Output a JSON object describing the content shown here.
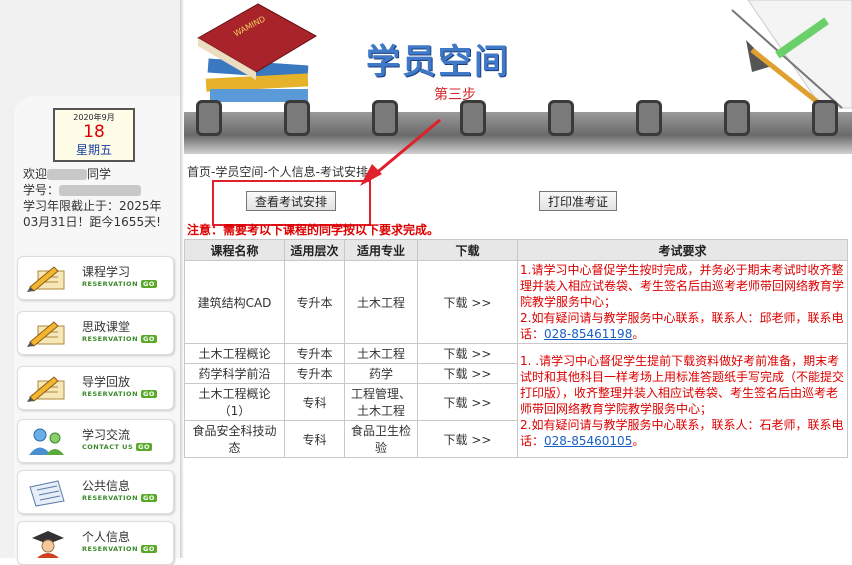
{
  "calendar": {
    "month_label": "2020年9月",
    "day": "18",
    "weekday": "星期五"
  },
  "welcome": {
    "greet_prefix": "欢迎",
    "greet_suffix": "同学",
    "id_label": "学号：",
    "deadline_text": "学习年限截止于：2025年03月31日！距今1655天!"
  },
  "nav": [
    {
      "label": "课程学习",
      "sub": "RESERVATION",
      "go": "GO",
      "icon": "pencil-paper-icon"
    },
    {
      "label": "思政课堂",
      "sub": "RESERVATION",
      "go": "GO",
      "icon": "pencil-paper-icon"
    },
    {
      "label": "导学回放",
      "sub": "RESERVATION",
      "go": "GO",
      "icon": "pencil-paper-icon"
    },
    {
      "label": "学习交流",
      "sub": "CONTACT US",
      "go": "GO",
      "icon": "people-icon"
    },
    {
      "label": "公共信息",
      "sub": "RESERVATION",
      "go": "GO",
      "icon": "notepad-icon"
    },
    {
      "label": "个人信息",
      "sub": "RESERVATION",
      "go": "GO",
      "icon": "graduate-icon"
    }
  ],
  "banner": {
    "title": "学员空间",
    "subtitle": "第三步",
    "book_text": "WAMIND"
  },
  "breadcrumb": "首页-学员空间-个人信息-考试安排",
  "actions": {
    "view_exam": "查看考试安排",
    "print_ticket": "打印准考证"
  },
  "notice": "注意：需要考以下课程的同学按以下要求完成。",
  "table": {
    "headers": [
      "课程名称",
      "适用层次",
      "适用专业",
      "下载",
      "考试要求"
    ],
    "rows": [
      {
        "course": "建筑结构CAD",
        "level": "专升本",
        "major": "土木工程",
        "download": "下载 >>"
      },
      {
        "course": "土木工程概论",
        "level": "专升本",
        "major": "土木工程",
        "download": "下载 >>"
      },
      {
        "course": "药学科学前沿",
        "level": "专升本",
        "major": "药学",
        "download": "下载 >>"
      },
      {
        "course": "土木工程概论（1）",
        "level": "专科",
        "major": "工程管理、土木工程",
        "download": "下载 >>"
      },
      {
        "course": "食品安全科技动态",
        "level": "专科",
        "major": "食品卫生检验",
        "download": "下载 >>"
      }
    ],
    "req1": {
      "text1": "1.请学习中心督促学生按时完成，并务必于期末考试时收齐整理并装入相应试卷袋、考生签名后由巡考老师带回网络教育学院教学服务中心；",
      "text2": "2.如有疑问请与教学服务中心联系，联系人：邱老师，联系电话：",
      "phone": "028-85461198",
      "end": "。"
    },
    "req2": {
      "text1": "1. .请学习中心督促学生提前下载资料做好考前准备，期末考试时和其他科目一样考场上用标准答题纸手写完成（不能提交打印版），收齐整理并装入相应试卷袋、考生签名后由巡考老师带回网络教育学院教学服务中心；",
      "text2": "2.如有疑问请与教学服务中心联系，联系人：石老师，联系电话：",
      "phone": "028-85460105",
      "end": "。"
    }
  },
  "colors": {
    "title_blue": "#3f79c8",
    "alert_red": "#d00000",
    "go_green": "#5aaa2a",
    "link_blue": "#1a5fc6"
  }
}
